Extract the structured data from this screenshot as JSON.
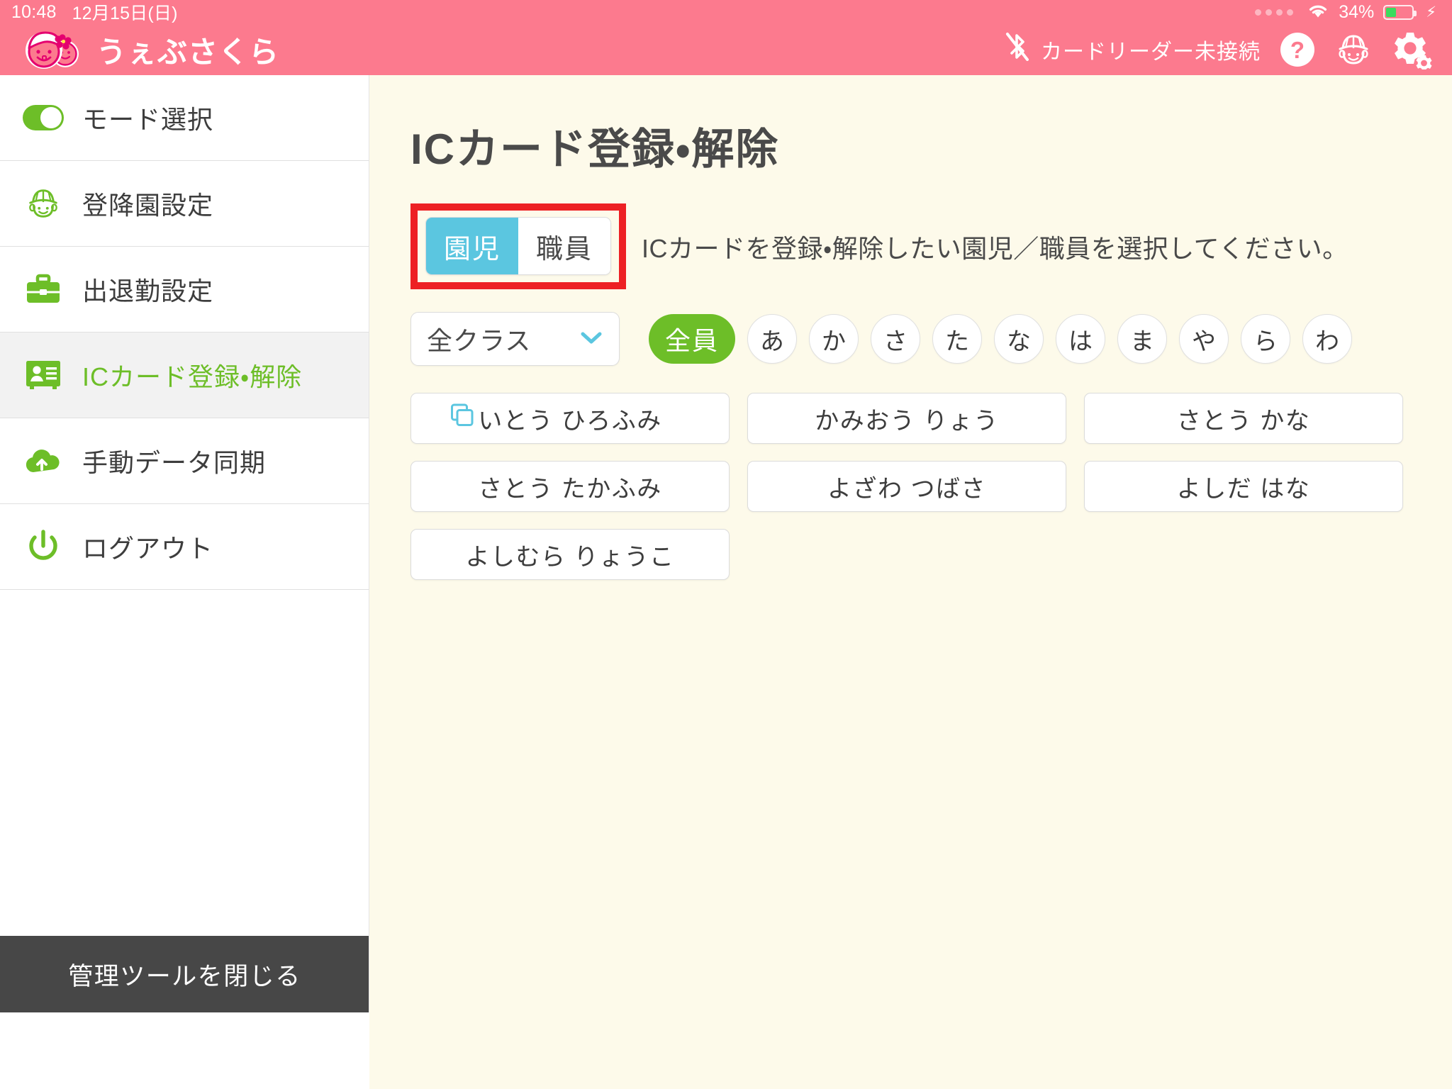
{
  "statusbar": {
    "time": "10:48",
    "date": "12月15日(日)",
    "battery_percent": "34%",
    "wifi_icon": "wifi-icon",
    "battery_icon": "battery-icon",
    "charging_icon": "charging-bolt-icon",
    "dots_icon": "signal-dots-icon"
  },
  "header": {
    "logo_text": "うぇぶさくら",
    "logo_icon": "sakura-children-logo-icon",
    "bluetooth_status": "カードリーダー未接続",
    "bluetooth_icon": "bluetooth-disconnected-icon",
    "help_icon": "question-mark-icon",
    "staff_icon": "child-with-hat-icon",
    "settings_icon": "gear-icon"
  },
  "sidebar": {
    "items": [
      {
        "label": "モード選択",
        "icon": "toggle-switch-icon",
        "active": false
      },
      {
        "label": "登降園設定",
        "icon": "child-with-hat-icon",
        "active": false
      },
      {
        "label": "出退勤設定",
        "icon": "briefcase-icon",
        "active": false
      },
      {
        "label": "ICカード登録・解除",
        "icon": "id-card-icon",
        "active": true
      },
      {
        "label": "手動データ同期",
        "icon": "cloud-upload-icon",
        "active": false
      },
      {
        "label": "ログアウト",
        "icon": "power-icon",
        "active": false
      }
    ],
    "footer_button": "管理ツールを閉じる"
  },
  "main": {
    "title": "ICカード登録・解除",
    "segmented": {
      "options": [
        "園児",
        "職員"
      ],
      "selected": "園児",
      "highlight_color": "#ED2024",
      "selected_color": "#5BC6E0"
    },
    "instruction": "ICカードを登録・解除したい園児／職員を選択してください。",
    "class_filter": {
      "value": "全クラス",
      "chevron_icon": "chevron-down-icon"
    },
    "all_button": "全員",
    "kana_buttons": [
      "あ",
      "か",
      "さ",
      "た",
      "な",
      "は",
      "ま",
      "や",
      "ら",
      "わ"
    ],
    "names": [
      {
        "label": "いとう ひろふみ",
        "has_card": true,
        "card_icon": "ic-card-registered-icon"
      },
      {
        "label": "かみおう りょう",
        "has_card": false
      },
      {
        "label": "さとう かな",
        "has_card": false
      },
      {
        "label": "さとう たかふみ",
        "has_card": false
      },
      {
        "label": "よざわ つばさ",
        "has_card": false
      },
      {
        "label": "よしだ はな",
        "has_card": false
      },
      {
        "label": "よしむら りょうこ",
        "has_card": false
      }
    ]
  },
  "colors": {
    "brand_pink": "#FC7A8E",
    "accent_green": "#6DBE28",
    "accent_cyan": "#5BC6E0",
    "content_bg": "#FDFAEA",
    "footer_dark": "#474747"
  }
}
